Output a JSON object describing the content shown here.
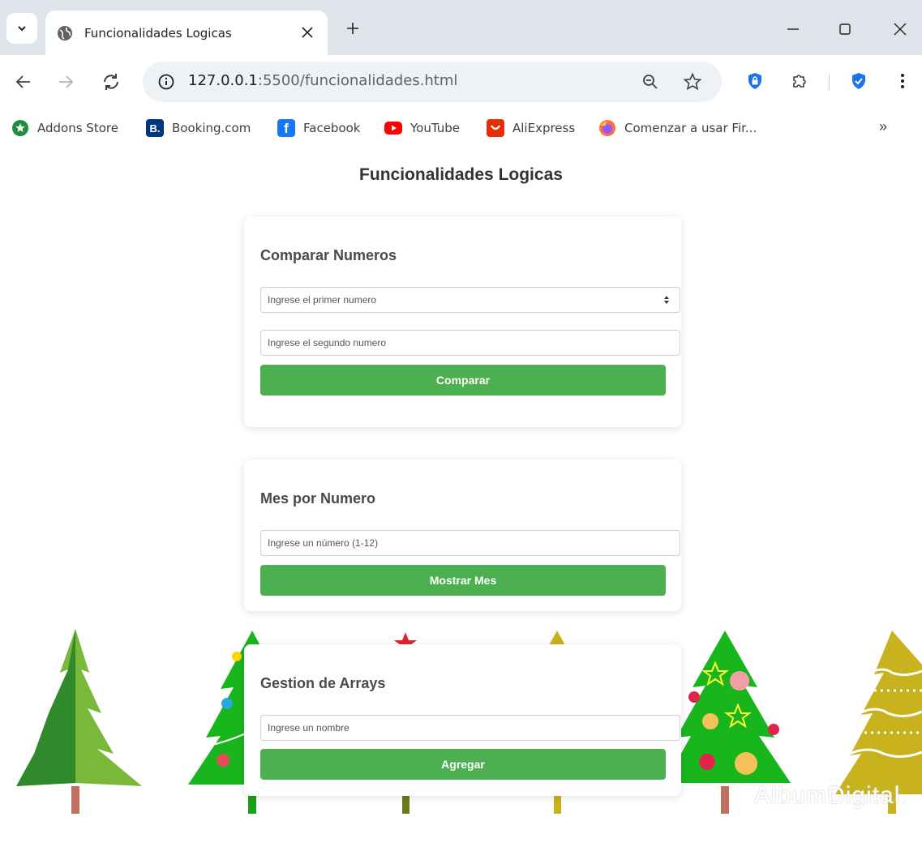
{
  "browser": {
    "tab_title": "Funcionalidades Logicas",
    "url_host": "127.0.0.1",
    "url_rest": ":5500/funcionalidades.html",
    "bookmarks": [
      {
        "label": "Addons Store",
        "icon": "addons-store-icon",
        "color": "#1e8e3e"
      },
      {
        "label": "Booking.com",
        "icon": "booking-icon",
        "color": "#003580",
        "glyph": "B."
      },
      {
        "label": "Facebook",
        "icon": "facebook-icon",
        "color": "#1877f2",
        "glyph": "f"
      },
      {
        "label": "YouTube",
        "icon": "youtube-icon",
        "color": "#ff0000"
      },
      {
        "label": "AliExpress",
        "icon": "aliexpress-icon",
        "color": "#e62e04"
      },
      {
        "label": "Comenzar a usar Fir...",
        "icon": "firefox-icon",
        "color": "#ff7139"
      }
    ],
    "more_bookmarks": "»"
  },
  "page": {
    "title": "Funcionalidades Logicas",
    "compare": {
      "heading": "Comparar Numeros",
      "first_placeholder": "Ingrese el primer numero",
      "second_placeholder": "Ingrese el segundo numero",
      "button": "Comparar"
    },
    "month": {
      "heading": "Mes por Numero",
      "placeholder": "Ingrese un número (1-12)",
      "button": "Mostrar Mes"
    },
    "arrays": {
      "heading": "Gestion de Arrays",
      "placeholder": "Ingrese un nombre",
      "button": "Agregar"
    },
    "watermark": "AlbumDigital."
  },
  "colors": {
    "button": "#4caf50",
    "heading": "#4a4a4a",
    "title": "#333333"
  }
}
